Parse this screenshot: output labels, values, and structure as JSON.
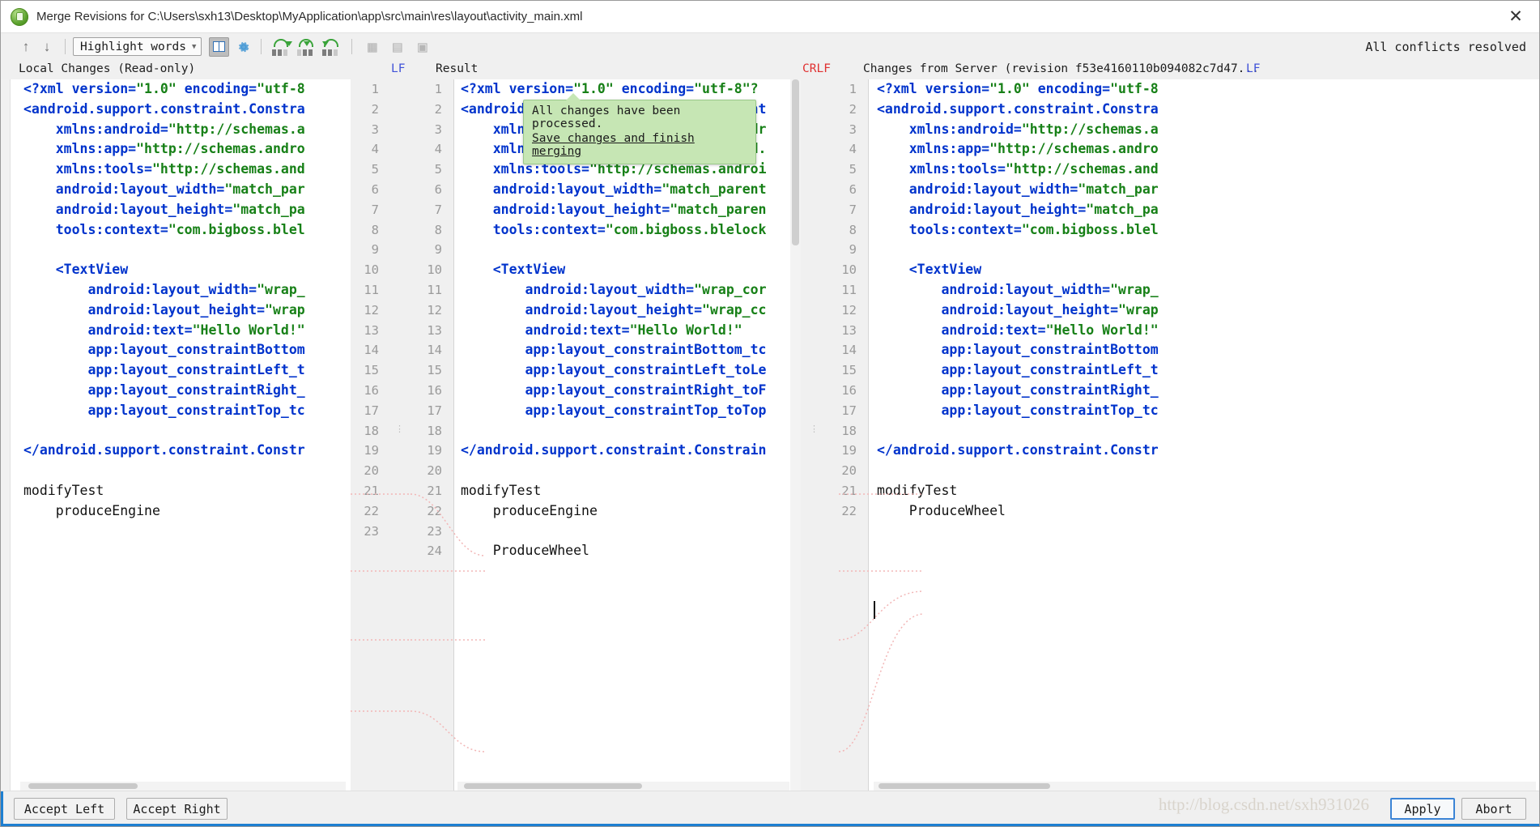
{
  "window": {
    "title": "Merge Revisions for C:\\Users\\sxh13\\Desktop\\MyApplication\\app\\src\\main\\res\\layout\\activity_main.xml",
    "close_label": "✕",
    "app_icon": "android-icon"
  },
  "toolbar": {
    "prev_label": "↑",
    "next_label": "↓",
    "highlight_mode": "Highlight words",
    "caret": "▾",
    "status": "All conflicts resolved"
  },
  "headers": {
    "left": "Local Changes (Read-only)",
    "left_sep": "LF",
    "center": "Result",
    "right_sep": "CRLF",
    "right": "Changes from Server (revision f53e4160110b094082c7d47...",
    "right_sep2": "LF"
  },
  "left_pane": {
    "lines": [
      [
        {
          "t": "<?",
          "c": "p"
        },
        {
          "t": "xml version=",
          "c": "k"
        },
        {
          "t": "\"1.0\"",
          "c": "s"
        },
        {
          "t": " encoding=",
          "c": "k"
        },
        {
          "t": "\"utf-8",
          "c": "s"
        }
      ],
      [
        {
          "t": "<android.support.constraint.Constra",
          "c": "k"
        }
      ],
      [
        {
          "t": "    xmlns:android=",
          "c": "k"
        },
        {
          "t": "\"http://schemas.a",
          "c": "s"
        }
      ],
      [
        {
          "t": "    xmlns:app=",
          "c": "k"
        },
        {
          "t": "\"http://schemas.andro",
          "c": "s"
        }
      ],
      [
        {
          "t": "    xmlns:tools=",
          "c": "k"
        },
        {
          "t": "\"http://schemas.and",
          "c": "s"
        }
      ],
      [
        {
          "t": "    android:layout_width=",
          "c": "k"
        },
        {
          "t": "\"match_par",
          "c": "s"
        }
      ],
      [
        {
          "t": "    android:layout_height=",
          "c": "k"
        },
        {
          "t": "\"match_pa",
          "c": "s"
        }
      ],
      [
        {
          "t": "    tools:context=",
          "c": "k"
        },
        {
          "t": "\"com.bigboss.blel",
          "c": "s"
        }
      ],
      [],
      [
        {
          "t": "    <TextView",
          "c": "k"
        }
      ],
      [
        {
          "t": "        android:layout_width=",
          "c": "k"
        },
        {
          "t": "\"wrap_",
          "c": "s"
        }
      ],
      [
        {
          "t": "        android:layout_height=",
          "c": "k"
        },
        {
          "t": "\"wrap",
          "c": "s"
        }
      ],
      [
        {
          "t": "        android:text=",
          "c": "k"
        },
        {
          "t": "\"Hello World!\"",
          "c": "s"
        }
      ],
      [
        {
          "t": "        app:layout_constraintBottom",
          "c": "k"
        }
      ],
      [
        {
          "t": "        app:layout_constraintLeft_t",
          "c": "k"
        }
      ],
      [
        {
          "t": "        app:layout_constraintRight_",
          "c": "k"
        }
      ],
      [
        {
          "t": "        app:layout_constraintTop_tc",
          "c": "k"
        }
      ],
      [],
      [
        {
          "t": "</android.support.constraint.Constr",
          "c": "k"
        }
      ],
      [],
      [
        {
          "t": "modifyTest",
          "c": "t"
        }
      ],
      [
        {
          "t": "    produceEngine",
          "c": "t"
        }
      ],
      [],
      []
    ],
    "line_numbers": [
      "1",
      "2",
      "3",
      "4",
      "5",
      "6",
      "7",
      "8",
      "9",
      "10",
      "11",
      "12",
      "13",
      "14",
      "15",
      "16",
      "17",
      "18",
      "19",
      "20",
      "21",
      "22",
      "23"
    ]
  },
  "center_pane": {
    "lines": [
      [
        {
          "t": "<?",
          "c": "p"
        },
        {
          "t": "xml version=",
          "c": "k"
        },
        {
          "t": "\"1.0\"",
          "c": "s"
        },
        {
          "t": " encoding=",
          "c": "k"
        },
        {
          "t": "\"utf-8\"?",
          "c": "s"
        }
      ],
      [
        {
          "t": "<android.support.constraint.Constraint",
          "c": "k"
        }
      ],
      [
        {
          "t": "    xmlns:android=",
          "c": "k"
        },
        {
          "t": "\"http://schemas.andr",
          "c": "s"
        }
      ],
      [
        {
          "t": "    xmlns:app=",
          "c": "k"
        },
        {
          "t": "\"http://schemas.android.",
          "c": "s"
        }
      ],
      [
        {
          "t": "    xmlns:tools=",
          "c": "k"
        },
        {
          "t": "\"http://schemas.androi",
          "c": "s"
        }
      ],
      [
        {
          "t": "    android:layout_width=",
          "c": "k"
        },
        {
          "t": "\"match_parent",
          "c": "s"
        }
      ],
      [
        {
          "t": "    android:layout_height=",
          "c": "k"
        },
        {
          "t": "\"match_paren",
          "c": "s"
        }
      ],
      [
        {
          "t": "    tools:context=",
          "c": "k"
        },
        {
          "t": "\"com.bigboss.blelock",
          "c": "s"
        }
      ],
      [],
      [
        {
          "t": "    <TextView",
          "c": "k"
        }
      ],
      [
        {
          "t": "        android:layout_width=",
          "c": "k"
        },
        {
          "t": "\"wrap_cor",
          "c": "s"
        }
      ],
      [
        {
          "t": "        android:layout_height=",
          "c": "k"
        },
        {
          "t": "\"wrap_cc",
          "c": "s"
        }
      ],
      [
        {
          "t": "        android:text=",
          "c": "k"
        },
        {
          "t": "\"Hello World!\"",
          "c": "s"
        }
      ],
      [
        {
          "t": "        app:layout_constraintBottom_tc",
          "c": "k"
        }
      ],
      [
        {
          "t": "        app:layout_constraintLeft_toLe",
          "c": "k"
        }
      ],
      [
        {
          "t": "        app:layout_constraintRight_toF",
          "c": "k"
        }
      ],
      [
        {
          "t": "        app:layout_constraintTop_toTop",
          "c": "k"
        }
      ],
      [],
      [
        {
          "t": "</android.support.constraint.Constrain",
          "c": "k"
        }
      ],
      [],
      [
        {
          "t": "modifyTest",
          "c": "t"
        }
      ],
      [
        {
          "t": "    produceEngine",
          "c": "t"
        }
      ],
      [],
      [
        {
          "t": "    ProduceWheel",
          "c": "t"
        }
      ]
    ],
    "line_numbers": [
      "1",
      "2",
      "3",
      "4",
      "5",
      "6",
      "7",
      "8",
      "9",
      "10",
      "11",
      "12",
      "13",
      "14",
      "15",
      "16",
      "17",
      "18",
      "19",
      "20",
      "21",
      "22",
      "23",
      "24"
    ]
  },
  "right_pane": {
    "lines": [
      [
        {
          "t": "<?",
          "c": "p"
        },
        {
          "t": "xml version=",
          "c": "k"
        },
        {
          "t": "\"1.0\"",
          "c": "s"
        },
        {
          "t": " encoding=",
          "c": "k"
        },
        {
          "t": "\"utf-8",
          "c": "s"
        }
      ],
      [
        {
          "t": "<android.support.constraint.Constra",
          "c": "k"
        }
      ],
      [
        {
          "t": "    xmlns:android=",
          "c": "k"
        },
        {
          "t": "\"http://schemas.a",
          "c": "s"
        }
      ],
      [
        {
          "t": "    xmlns:app=",
          "c": "k"
        },
        {
          "t": "\"http://schemas.andro",
          "c": "s"
        }
      ],
      [
        {
          "t": "    xmlns:tools=",
          "c": "k"
        },
        {
          "t": "\"http://schemas.and",
          "c": "s"
        }
      ],
      [
        {
          "t": "    android:layout_width=",
          "c": "k"
        },
        {
          "t": "\"match_par",
          "c": "s"
        }
      ],
      [
        {
          "t": "    android:layout_height=",
          "c": "k"
        },
        {
          "t": "\"match_pa",
          "c": "s"
        }
      ],
      [
        {
          "t": "    tools:context=",
          "c": "k"
        },
        {
          "t": "\"com.bigboss.blel",
          "c": "s"
        }
      ],
      [],
      [
        {
          "t": "    <TextView",
          "c": "k"
        }
      ],
      [
        {
          "t": "        android:layout_width=",
          "c": "k"
        },
        {
          "t": "\"wrap_",
          "c": "s"
        }
      ],
      [
        {
          "t": "        android:layout_height=",
          "c": "k"
        },
        {
          "t": "\"wrap",
          "c": "s"
        }
      ],
      [
        {
          "t": "        android:text=",
          "c": "k"
        },
        {
          "t": "\"Hello World!\"",
          "c": "s"
        }
      ],
      [
        {
          "t": "        app:layout_constraintBottom",
          "c": "k"
        }
      ],
      [
        {
          "t": "        app:layout_constraintLeft_t",
          "c": "k"
        }
      ],
      [
        {
          "t": "        app:layout_constraintRight_",
          "c": "k"
        }
      ],
      [
        {
          "t": "        app:layout_constraintTop_tc",
          "c": "k"
        }
      ],
      [],
      [
        {
          "t": "</android.support.constraint.Constr",
          "c": "k"
        }
      ],
      [],
      [
        {
          "t": "modifyTest",
          "c": "t"
        }
      ],
      [
        {
          "t": "    ProduceWheel",
          "c": "t"
        }
      ]
    ],
    "line_numbers": [
      "1",
      "2",
      "3",
      "4",
      "5",
      "6",
      "7",
      "8",
      "9",
      "10",
      "11",
      "12",
      "13",
      "14",
      "15",
      "16",
      "17",
      "18",
      "19",
      "20",
      "21",
      "22"
    ]
  },
  "balloon": {
    "message": "All changes have been processed.",
    "link": "Save changes and finish merging"
  },
  "footer": {
    "accept_left": "Accept Left",
    "accept_right": "Accept Right",
    "apply": "Apply",
    "abort": "Abort",
    "watermark": "http://blog.csdn.net/sxh931026"
  },
  "colors": {
    "accent": "#1d7fd1",
    "keyword": "#0033cc",
    "string": "#178017",
    "balloon_bg": "#c6e6b4",
    "crlf": "#e03030",
    "lf": "#3f51d8"
  }
}
